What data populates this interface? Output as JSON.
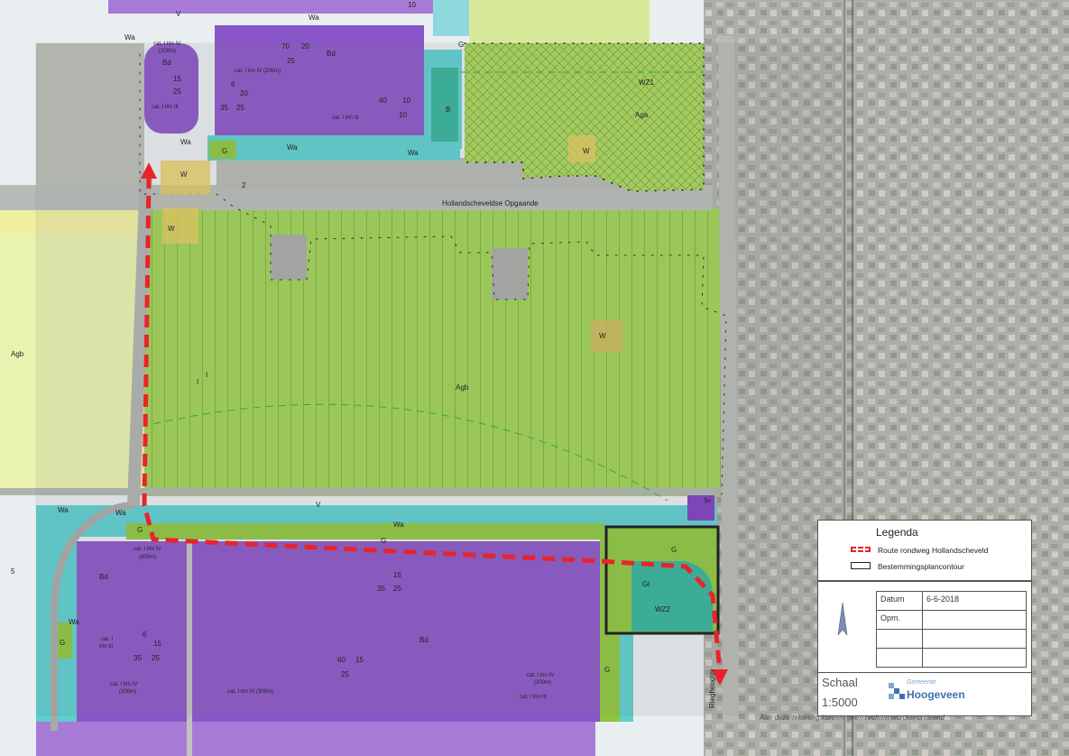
{
  "map": {
    "road_label": "Hollandscheveldse Opgaande",
    "street_label_right": "Riegheogter"
  },
  "zones": {
    "agb_left": "Agb",
    "agb_center": "Agb",
    "aga": "Aga",
    "wz1": "WZ1",
    "wz2": "WZ2",
    "bd_top": "Bd",
    "bd_bottom_left": "Bd",
    "bd_bottom_center": "Bd",
    "bd_small": "Bd",
    "wa_top": "Wa",
    "wa_top_left": "Wa",
    "wa_mid": "Wa",
    "wa_mid2": "Wa",
    "wa_bottom_left": "Wa",
    "wa_bottom": "Wa",
    "wa_bottom2": "Wa",
    "wa_left": "Wa",
    "g1": "G",
    "g2": "G",
    "g3": "G",
    "g4": "G",
    "g5": "G",
    "g6": "G",
    "gi": "Gl",
    "w1": "W",
    "w2": "W",
    "w3": "W",
    "w4": "W",
    "b": "B",
    "v1": "V",
    "v2": "V",
    "sv": "Sv",
    "i1": "I",
    "i2": "I"
  },
  "annotations": {
    "cat_a": "cat. I t/m IV",
    "cat_a2": "(200m)",
    "cat_b": "cat. I t/m IV (200m)",
    "cat_c": "cat. I t/m III",
    "cat_d": "cat. I t/m III",
    "cat_e": "cat. I t/m IV",
    "cat_e2": "(300m)",
    "cat_f": "cat. I",
    "cat_f2": "t/m III",
    "cat_g": "cat. I t/m IV",
    "cat_g2": "(200m)",
    "cat_h": "cat. I t/m IV (300m)",
    "cat_i": "cat. I t/m IV",
    "cat_i2": "(200m)",
    "cat_j": "cat. I t/m III",
    "n_70": "70",
    "n_20a": "20",
    "n_25a": "25",
    "n_6": "6",
    "n_20b": "20",
    "n_35a": "35",
    "n_25b": "25",
    "n_40": "40",
    "n_10a": "10",
    "n_10b": "10",
    "n_15a": "15",
    "n_25c": "25",
    "n_15b": "15",
    "n_35b": "35",
    "n_25d": "25",
    "n_6b": "6",
    "n_15c": "15",
    "n_35c": "35",
    "n_25e": "25",
    "n_60": "60",
    "n_15d": "15",
    "n_25f": "25",
    "n_2": "2",
    "n_10c": "10",
    "n_5": "5"
  },
  "legend": {
    "title": "Legenda",
    "route_label": "Route rondweg Hollandscheveld",
    "plan_label": "Bestemmingsplancontour"
  },
  "info": {
    "datum_label": "Datum",
    "datum_value": "6-6-2018",
    "opm_label": "Opm.",
    "schaal_label": "Schaal",
    "schaal_value": "1:5000"
  },
  "logo": {
    "small": "Gemeente",
    "big": "Hoogeveen"
  },
  "disclaimer": "Aan deze tekening kunnen geen rechten worden ontleend",
  "colors": {
    "agrarisch": "#a8d65a",
    "agrarisch_light": "#e8f0a8",
    "bedrijf": "#8a55c8",
    "water": "#5ccfd0",
    "groen": "#8cc63f",
    "wonen": "#d8c060",
    "route": "#e8242a",
    "photo": "#9a9c98"
  }
}
